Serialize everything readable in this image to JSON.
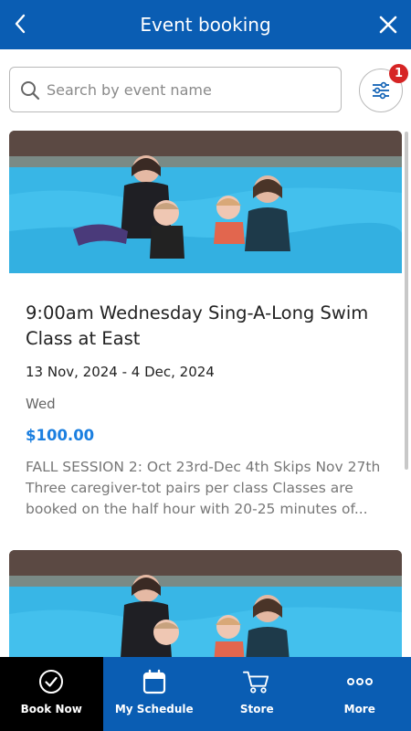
{
  "header": {
    "title": "Event booking"
  },
  "search": {
    "placeholder": "Search by event name",
    "value": ""
  },
  "filter": {
    "badge_count": "1"
  },
  "colors": {
    "brand_blue": "#0a5db3",
    "price_blue": "#1b7fe0",
    "badge_red": "#d62424"
  },
  "events": [
    {
      "title": "9:00am Wednesday Sing-A-Long Swim Class at East",
      "dates": "13 Nov, 2024 - 4 Dec, 2024",
      "day": "Wed",
      "price": "$100.00",
      "description": "FALL SESSION 2: Oct 23rd-Dec 4th Skips Nov 27th Three caregiver-tot pairs per class Classes are booked on the half hour with 20-25 minutes of..."
    },
    {
      "title": "",
      "dates": "",
      "day": "",
      "price": "",
      "description": ""
    }
  ],
  "nav": {
    "items": [
      {
        "label": "Book Now",
        "icon": "check-circle-icon",
        "active": true
      },
      {
        "label": "My Schedule",
        "icon": "calendar-icon",
        "active": false
      },
      {
        "label": "Store",
        "icon": "cart-icon",
        "active": false
      },
      {
        "label": "More",
        "icon": "more-dots-icon",
        "active": false
      }
    ]
  }
}
